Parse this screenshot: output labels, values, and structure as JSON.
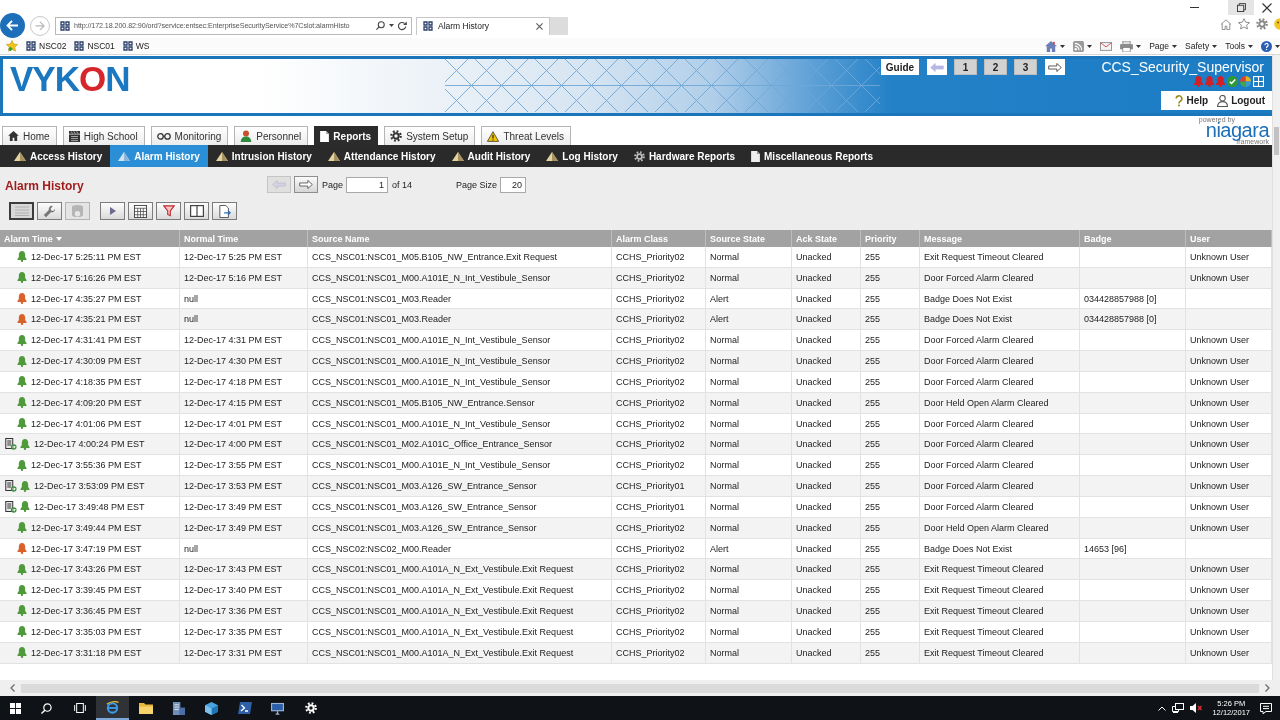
{
  "browser": {
    "url": "http://172.18.200.82:90/ord?service:entsec:EnterpriseSecurityService%7Cslot:alarmHisto",
    "tab": "Alarm History",
    "favorites": [
      "NSC02",
      "NSC01",
      "WS"
    ],
    "menus": [
      "Page",
      "Safety",
      "Tools"
    ]
  },
  "banner": {
    "logo": "VYKON",
    "guide": "Guide",
    "arrows": [
      {
        "disabled": true
      },
      {
        "disabled": false
      }
    ],
    "pages": [
      "1",
      "2",
      "3"
    ],
    "user": "CCS_Security_Supervisor",
    "help": "Help",
    "logout": "Logout"
  },
  "niagara": {
    "powered_by": "powered by",
    "name": "niagara",
    "tagline": "framework"
  },
  "tabs": [
    {
      "label": "Home",
      "selected": false
    },
    {
      "label": "High School",
      "selected": false
    },
    {
      "label": "Monitoring",
      "selected": false
    },
    {
      "label": "Personnel",
      "selected": false
    },
    {
      "label": "Reports",
      "selected": true
    },
    {
      "label": "System Setup",
      "selected": false
    },
    {
      "label": "Threat Levels",
      "selected": false
    }
  ],
  "subnav": [
    {
      "label": "Access History",
      "selected": false
    },
    {
      "label": "Alarm History",
      "selected": true
    },
    {
      "label": "Intrusion History",
      "selected": false
    },
    {
      "label": "Attendance History",
      "selected": false
    },
    {
      "label": "Audit History",
      "selected": false
    },
    {
      "label": "Log History",
      "selected": false
    },
    {
      "label": "Hardware Reports",
      "selected": false
    },
    {
      "label": "Miscellaneous Reports",
      "selected": false
    }
  ],
  "report": {
    "title": "Alarm History",
    "pager": {
      "arrows": [
        {
          "disabled": true
        },
        {
          "disabled": false
        }
      ],
      "page_label": "Page",
      "page": "1",
      "total": "of 14",
      "size_label": "Page Size",
      "size": "20"
    },
    "toolbar": [
      {
        "pressed": true,
        "disabled": false
      },
      {
        "pressed": false,
        "disabled": false
      },
      {
        "pressed": false,
        "disabled": true
      },
      {
        "pressed": false,
        "disabled": false
      },
      {
        "pressed": false,
        "disabled": false
      },
      {
        "pressed": false,
        "disabled": false
      },
      {
        "pressed": false,
        "disabled": false
      },
      {
        "pressed": false,
        "disabled": false
      }
    ]
  },
  "table": {
    "columns": [
      {
        "label": "Alarm Time",
        "sorted": true
      },
      {
        "label": "Normal Time",
        "sorted": false
      },
      {
        "label": "Source Name",
        "sorted": false
      },
      {
        "label": "Alarm Class",
        "sorted": false
      },
      {
        "label": "Source State",
        "sorted": false
      },
      {
        "label": "Ack State",
        "sorted": false
      },
      {
        "label": "Priority",
        "sorted": false
      },
      {
        "label": "Message",
        "sorted": false
      },
      {
        "label": "Badge",
        "sorted": false
      },
      {
        "label": "User",
        "sorted": false
      }
    ],
    "rows": [
      {
        "has_note": false,
        "color": "#4f9a3b",
        "alarm_time": "12-Dec-17 5:25:11 PM EST",
        "normal_time": "12-Dec-17 5:25 PM EST",
        "source_name": "CCS_NSC01:NSC01_M05.B105_NW_Entrance.Exit Request",
        "alarm_class": "CCHS_Priority02",
        "source_state": "Normal",
        "ack_state": "Unacked",
        "priority": "255",
        "message": "Exit Request Timeout Cleared",
        "user": "Unknown User"
      },
      {
        "has_note": false,
        "color": "#4f9a3b",
        "alarm_time": "12-Dec-17 5:16:26 PM EST",
        "normal_time": "12-Dec-17 5:16 PM EST",
        "source_name": "CCS_NSC01:NSC01_M00.A101E_N_Int_Vestibule_Sensor",
        "alarm_class": "CCHS_Priority02",
        "source_state": "Normal",
        "ack_state": "Unacked",
        "priority": "255",
        "message": "Door Forced Alarm Cleared",
        "user": "Unknown User"
      },
      {
        "has_note": false,
        "color": "#d9622b",
        "alarm_time": "12-Dec-17 4:35:27 PM EST",
        "normal_time": "null",
        "source_name": "CCS_NSC01:NSC01_M03.Reader",
        "alarm_class": "CCHS_Priority02",
        "source_state": "Alert",
        "ack_state": "Unacked",
        "priority": "255",
        "message": "Badge Does Not Exist",
        "badge": "034428857988 [0]"
      },
      {
        "has_note": false,
        "color": "#d9622b",
        "alarm_time": "12-Dec-17 4:35:21 PM EST",
        "normal_time": "null",
        "source_name": "CCS_NSC01:NSC01_M03.Reader",
        "alarm_class": "CCHS_Priority02",
        "source_state": "Alert",
        "ack_state": "Unacked",
        "priority": "255",
        "message": "Badge Does Not Exist",
        "badge": "034428857988 [0]"
      },
      {
        "has_note": false,
        "color": "#4f9a3b",
        "alarm_time": "12-Dec-17 4:31:41 PM EST",
        "normal_time": "12-Dec-17 4:31 PM EST",
        "source_name": "CCS_NSC01:NSC01_M00.A101E_N_Int_Vestibule_Sensor",
        "alarm_class": "CCHS_Priority02",
        "source_state": "Normal",
        "ack_state": "Unacked",
        "priority": "255",
        "message": "Door Forced Alarm Cleared",
        "user": "Unknown User"
      },
      {
        "has_note": false,
        "color": "#4f9a3b",
        "alarm_time": "12-Dec-17 4:30:09 PM EST",
        "normal_time": "12-Dec-17 4:30 PM EST",
        "source_name": "CCS_NSC01:NSC01_M00.A101E_N_Int_Vestibule_Sensor",
        "alarm_class": "CCHS_Priority02",
        "source_state": "Normal",
        "ack_state": "Unacked",
        "priority": "255",
        "message": "Door Forced Alarm Cleared",
        "user": "Unknown User"
      },
      {
        "has_note": false,
        "color": "#4f9a3b",
        "alarm_time": "12-Dec-17 4:18:35 PM EST",
        "normal_time": "12-Dec-17 4:18 PM EST",
        "source_name": "CCS_NSC01:NSC01_M00.A101E_N_Int_Vestibule_Sensor",
        "alarm_class": "CCHS_Priority02",
        "source_state": "Normal",
        "ack_state": "Unacked",
        "priority": "255",
        "message": "Door Forced Alarm Cleared",
        "user": "Unknown User"
      },
      {
        "has_note": false,
        "color": "#4f9a3b",
        "alarm_time": "12-Dec-17 4:09:20 PM EST",
        "normal_time": "12-Dec-17 4:15 PM EST",
        "source_name": "CCS_NSC01:NSC01_M05.B105_NW_Entrance.Sensor",
        "alarm_class": "CCHS_Priority02",
        "source_state": "Normal",
        "ack_state": "Unacked",
        "priority": "255",
        "message": "Door Held Open Alarm Cleared",
        "user": "Unknown User"
      },
      {
        "has_note": false,
        "color": "#4f9a3b",
        "alarm_time": "12-Dec-17 4:01:06 PM EST",
        "normal_time": "12-Dec-17 4:01 PM EST",
        "source_name": "CCS_NSC01:NSC01_M00.A101E_N_Int_Vestibule_Sensor",
        "alarm_class": "CCHS_Priority02",
        "source_state": "Normal",
        "ack_state": "Unacked",
        "priority": "255",
        "message": "Door Forced Alarm Cleared",
        "user": "Unknown User"
      },
      {
        "has_note": true,
        "color": "#4f9a3b",
        "alarm_time": "12-Dec-17 4:00:24 PM EST",
        "normal_time": "12-Dec-17 4:00 PM EST",
        "source_name": "CCS_NSC01:NSC01_M02.A101C_Office_Entrance_Sensor",
        "alarm_class": "CCHS_Priority02",
        "source_state": "Normal",
        "ack_state": "Unacked",
        "priority": "255",
        "message": "Door Forced Alarm Cleared",
        "user": "Unknown User"
      },
      {
        "has_note": false,
        "color": "#4f9a3b",
        "alarm_time": "12-Dec-17 3:55:36 PM EST",
        "normal_time": "12-Dec-17 3:55 PM EST",
        "source_name": "CCS_NSC01:NSC01_M00.A101E_N_Int_Vestibule_Sensor",
        "alarm_class": "CCHS_Priority02",
        "source_state": "Normal",
        "ack_state": "Unacked",
        "priority": "255",
        "message": "Door Forced Alarm Cleared",
        "user": "Unknown User"
      },
      {
        "has_note": true,
        "color": "#4f9a3b",
        "alarm_time": "12-Dec-17 3:53:09 PM EST",
        "normal_time": "12-Dec-17 3:53 PM EST",
        "source_name": "CCS_NSC01:NSC01_M03.A126_SW_Entrance_Sensor",
        "alarm_class": "CCHS_Priority01",
        "source_state": "Normal",
        "ack_state": "Unacked",
        "priority": "255",
        "message": "Door Forced Alarm Cleared",
        "user": "Unknown User"
      },
      {
        "has_note": true,
        "color": "#4f9a3b",
        "alarm_time": "12-Dec-17 3:49:48 PM EST",
        "normal_time": "12-Dec-17 3:49 PM EST",
        "source_name": "CCS_NSC01:NSC01_M03.A126_SW_Entrance_Sensor",
        "alarm_class": "CCHS_Priority01",
        "source_state": "Normal",
        "ack_state": "Unacked",
        "priority": "255",
        "message": "Door Forced Alarm Cleared",
        "user": "Unknown User"
      },
      {
        "has_note": false,
        "color": "#4f9a3b",
        "alarm_time": "12-Dec-17 3:49:44 PM EST",
        "normal_time": "12-Dec-17 3:49 PM EST",
        "source_name": "CCS_NSC01:NSC01_M03.A126_SW_Entrance_Sensor",
        "alarm_class": "CCHS_Priority02",
        "source_state": "Normal",
        "ack_state": "Unacked",
        "priority": "255",
        "message": "Door Held Open Alarm Cleared",
        "user": "Unknown User"
      },
      {
        "has_note": false,
        "color": "#d9622b",
        "alarm_time": "12-Dec-17 3:47:19 PM EST",
        "normal_time": "null",
        "source_name": "CCS_NSC02:NSC02_M00.Reader",
        "alarm_class": "CCHS_Priority02",
        "source_state": "Alert",
        "ack_state": "Unacked",
        "priority": "255",
        "message": "Badge Does Not Exist",
        "badge": "14653 [96]"
      },
      {
        "has_note": false,
        "color": "#4f9a3b",
        "alarm_time": "12-Dec-17 3:43:26 PM EST",
        "normal_time": "12-Dec-17 3:43 PM EST",
        "source_name": "CCS_NSC01:NSC01_M00.A101A_N_Ext_Vestibule.Exit Request",
        "alarm_class": "CCHS_Priority02",
        "source_state": "Normal",
        "ack_state": "Unacked",
        "priority": "255",
        "message": "Exit Request Timeout Cleared",
        "user": "Unknown User"
      },
      {
        "has_note": false,
        "color": "#4f9a3b",
        "alarm_time": "12-Dec-17 3:39:45 PM EST",
        "normal_time": "12-Dec-17 3:40 PM EST",
        "source_name": "CCS_NSC01:NSC01_M00.A101A_N_Ext_Vestibule.Exit Request",
        "alarm_class": "CCHS_Priority02",
        "source_state": "Normal",
        "ack_state": "Unacked",
        "priority": "255",
        "message": "Exit Request Timeout Cleared",
        "user": "Unknown User"
      },
      {
        "has_note": false,
        "color": "#4f9a3b",
        "alarm_time": "12-Dec-17 3:36:45 PM EST",
        "normal_time": "12-Dec-17 3:36 PM EST",
        "source_name": "CCS_NSC01:NSC01_M00.A101A_N_Ext_Vestibule.Exit Request",
        "alarm_class": "CCHS_Priority02",
        "source_state": "Normal",
        "ack_state": "Unacked",
        "priority": "255",
        "message": "Exit Request Timeout Cleared",
        "user": "Unknown User"
      },
      {
        "has_note": false,
        "color": "#4f9a3b",
        "alarm_time": "12-Dec-17 3:35:03 PM EST",
        "normal_time": "12-Dec-17 3:35 PM EST",
        "source_name": "CCS_NSC01:NSC01_M00.A101A_N_Ext_Vestibule.Exit Request",
        "alarm_class": "CCHS_Priority02",
        "source_state": "Normal",
        "ack_state": "Unacked",
        "priority": "255",
        "message": "Exit Request Timeout Cleared",
        "user": "Unknown User"
      },
      {
        "has_note": false,
        "color": "#4f9a3b",
        "alarm_time": "12-Dec-17 3:31:18 PM EST",
        "normal_time": "12-Dec-17 3:31 PM EST",
        "source_name": "CCS_NSC01:NSC01_M00.A101A_N_Ext_Vestibule.Exit Request",
        "alarm_class": "CCHS_Priority02",
        "source_state": "Normal",
        "ack_state": "Unacked",
        "priority": "255",
        "message": "Exit Request Timeout Cleared",
        "user": "Unknown User"
      }
    ]
  },
  "taskbar": {
    "apps": [
      {
        "selected": true
      },
      {
        "selected": false
      },
      {
        "selected": false
      },
      {
        "selected": false
      },
      {
        "selected": false
      },
      {
        "selected": false
      },
      {
        "selected": false
      }
    ],
    "time": "5:26 PM",
    "date": "12/12/2017"
  }
}
